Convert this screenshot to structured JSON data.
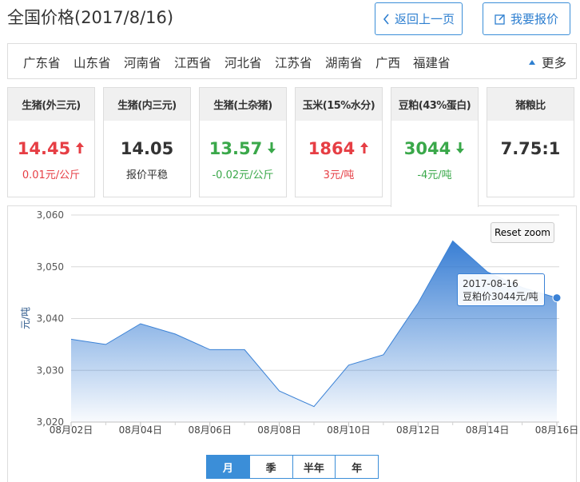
{
  "header": {
    "title": "全国价格(2017/8/16)",
    "back_label": "返回上一页",
    "report_label": "我要报价"
  },
  "provinces": [
    "广东省",
    "山东省",
    "河南省",
    "江西省",
    "河北省",
    "江苏省",
    "湖南省",
    "广西",
    "福建省"
  ],
  "more_label": "更多",
  "cards": [
    {
      "title": "生猪(外三元)",
      "value": "14.45",
      "change": "0.01元/公斤",
      "trend": "up"
    },
    {
      "title": "生猪(内三元)",
      "value": "14.05",
      "change": "报价平稳",
      "trend": "flat"
    },
    {
      "title": "生猪(土杂猪)",
      "value": "13.57",
      "change": "-0.02元/公斤",
      "trend": "down"
    },
    {
      "title": "玉米(15%水分)",
      "value": "1864",
      "change": "3元/吨",
      "trend": "up"
    },
    {
      "title": "豆粕(43%蛋白)",
      "value": "3044",
      "change": "-4元/吨",
      "trend": "down"
    },
    {
      "title": "猪粮比",
      "value": "7.75:1",
      "change": "",
      "trend": "none"
    }
  ],
  "colors": {
    "up": "#e63e44",
    "down": "#3aa84a",
    "accent": "#3b8ed8",
    "series": "#3b82d6"
  },
  "reset_zoom_label": "Reset zoom",
  "tooltip": {
    "date": "2017-08-16",
    "text": "豆粕价3044元/吨"
  },
  "range_tabs": [
    "月",
    "季",
    "半年",
    "年"
  ],
  "active_range": "月",
  "chart_data": {
    "type": "area",
    "ylabel": "元/吨",
    "ylim": [
      3020,
      3060
    ],
    "yticks": [
      "3,020",
      "3,030",
      "3,040",
      "3,050",
      "3,060"
    ],
    "ytick_values": [
      3020,
      3030,
      3040,
      3050,
      3060
    ],
    "x": [
      "2017-08-02",
      "2017-08-03",
      "2017-08-04",
      "2017-08-05",
      "2017-08-06",
      "2017-08-07",
      "2017-08-08",
      "2017-08-09",
      "2017-08-10",
      "2017-08-11",
      "2017-08-12",
      "2017-08-13",
      "2017-08-14",
      "2017-08-15",
      "2017-08-16"
    ],
    "xticks": [
      "08月02日",
      "08月04日",
      "08月06日",
      "08月08日",
      "08月10日",
      "08月12日",
      "08月14日",
      "08月16日"
    ],
    "series": [
      {
        "values": [
          3036,
          3035,
          3039,
          3037,
          3034,
          3034,
          3026,
          3023,
          3031,
          3033,
          3043,
          3055,
          3049,
          3046,
          3044
        ]
      }
    ],
    "grid": true
  }
}
